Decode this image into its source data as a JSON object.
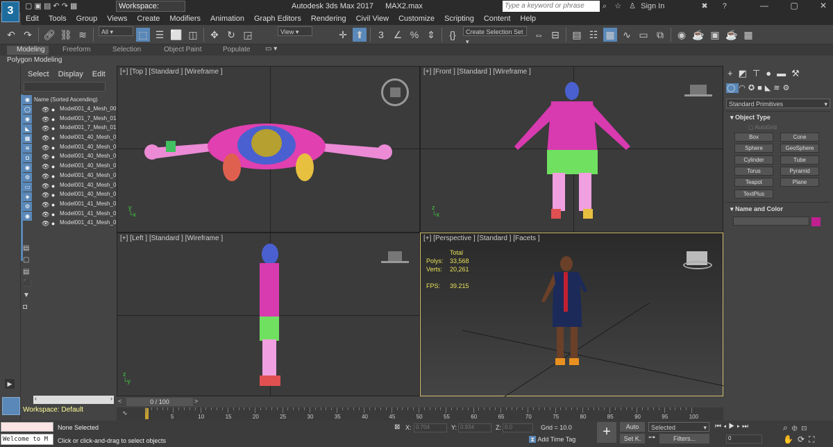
{
  "app": {
    "logo_label": "3",
    "logo_sub": "MAX",
    "title": "Autodesk 3ds Max 2017",
    "filename": "MAX2.max",
    "workspace": "Workspace: Default",
    "search_placeholder": "Type a keyword or phrase",
    "sign_in": "Sign In"
  },
  "menu": [
    "Edit",
    "Tools",
    "Group",
    "Views",
    "Create",
    "Modifiers",
    "Animation",
    "Graph Editors",
    "Rendering",
    "Civil View",
    "Customize",
    "Scripting",
    "Content",
    "Help"
  ],
  "toolbar": {
    "filter": "All",
    "view": "View",
    "selection_set": "Create Selection Set"
  },
  "ribbon": {
    "tabs": [
      "Modeling",
      "Freeform",
      "Selection",
      "Object Paint",
      "Populate"
    ],
    "subtitle": "Polygon Modeling"
  },
  "scene_explorer": {
    "tabs": [
      "Select",
      "Display",
      "Edit"
    ],
    "header": "Name (Sorted Ascending)",
    "items": [
      "Model001_4_Mesh_00",
      "Model001_7_Mesh_01",
      "Model001_7_Mesh_01",
      "Model001_40_Mesh_0",
      "Model001_40_Mesh_0",
      "Model001_40_Mesh_0",
      "Model001_40_Mesh_0",
      "Model001_40_Mesh_0",
      "Model001_40_Mesh_0",
      "Model001_40_Mesh_0",
      "Model001_41_Mesh_0",
      "Model001_41_Mesh_0",
      "Model001_41_Mesh_0"
    ],
    "workspace": "Workspace: Default"
  },
  "viewports": {
    "top": "[+] [Top ] [Standard ] [Wireframe ]",
    "front": "[+] [Front ] [Standard ] [Wireframe ]",
    "left": "[+] [Left ] [Standard ] [Wireframe ]",
    "persp": "[+] [Perspective ] [Standard ] [Facets ]",
    "stats": {
      "total": "Total",
      "polys_label": "Polys:",
      "polys": "33,568",
      "verts_label": "Verts:",
      "verts": "20,261",
      "fps_label": "FPS:",
      "fps": "39.215"
    }
  },
  "command_panel": {
    "dropdown": "Standard Primitives",
    "object_type": "Object Type",
    "autogrid": "AutoGrid",
    "buttons": [
      "Box",
      "Cone",
      "Sphere",
      "GeoSphere",
      "Cylinder",
      "Tube",
      "Torus",
      "Pyramid",
      "Teapot",
      "Plane",
      "TextPlus"
    ],
    "name_color": "Name and Color",
    "color": "#c0208f"
  },
  "timeline": {
    "frame": "0 / 100",
    "ticks": [
      "5",
      "10",
      "15",
      "20",
      "25",
      "30",
      "35",
      "40",
      "45",
      "50",
      "55",
      "60",
      "65",
      "70",
      "75",
      "80",
      "85",
      "90",
      "95",
      "100"
    ]
  },
  "status": {
    "script_text": "Welcome to M",
    "selected": "None Selected",
    "hint": "Click or click-and-drag to select objects",
    "x_label": "X:",
    "x": "0.704",
    "y_label": "Y:",
    "y": "0.934",
    "z_label": "Z:",
    "z": "0.0",
    "grid": "Grid = 10.0",
    "add_time_tag": "Add Time Tag",
    "auto": "Auto",
    "set_k": "Set K.",
    "selected_mode": "Selected",
    "filters": "Filters...",
    "frame": "0"
  }
}
